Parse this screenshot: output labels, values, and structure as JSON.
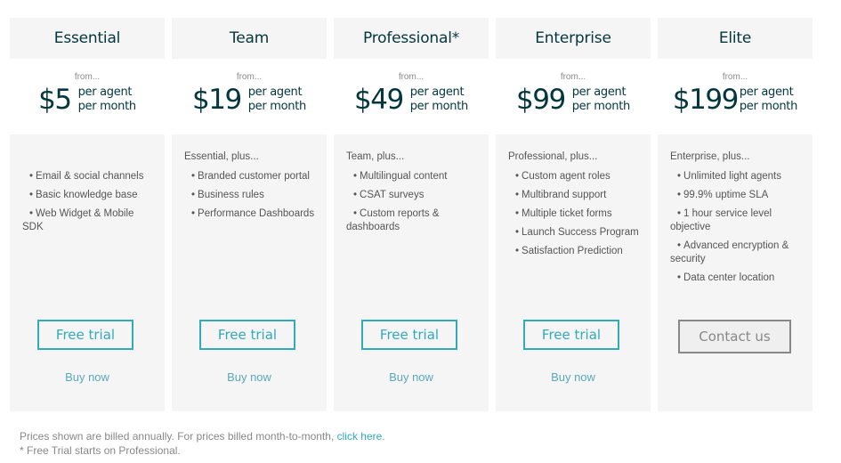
{
  "colors": {
    "accent": "#30aabc",
    "heading": "#03363d",
    "panel_bg": "#f5f5f5",
    "muted": "#888888"
  },
  "plans": [
    {
      "name": "Essential",
      "from": "from...",
      "price": "$5",
      "per_line1": "per agent",
      "per_line2": "per month",
      "intro": "",
      "features": [
        "Email & social channels",
        "Basic knowledge base",
        "Web Widget & Mobile SDK"
      ],
      "cta": "Free trial",
      "buy": "Buy now"
    },
    {
      "name": "Team",
      "from": "from...",
      "price": "$19",
      "per_line1": "per agent",
      "per_line2": "per month",
      "intro": "Essential, plus...",
      "features": [
        "Branded customer portal",
        "Business rules",
        "Performance Dashboards"
      ],
      "cta": "Free trial",
      "buy": "Buy now"
    },
    {
      "name": "Professional*",
      "from": "from...",
      "price": "$49",
      "per_line1": "per agent",
      "per_line2": "per month",
      "intro": "Team, plus...",
      "features": [
        "Multilingual content",
        "CSAT surveys",
        "Custom reports & dashboards"
      ],
      "cta": "Free trial",
      "buy": "Buy now"
    },
    {
      "name": "Enterprise",
      "from": "from...",
      "price": "$99",
      "per_line1": "per agent",
      "per_line2": "per month",
      "intro": "Professional, plus...",
      "features": [
        "Custom agent roles",
        "Multibrand support",
        "Multiple ticket forms",
        "Launch Success Program",
        "Satisfaction Prediction"
      ],
      "cta": "Free trial",
      "buy": "Buy now"
    },
    {
      "name": "Elite",
      "from": "from...",
      "price": "$199",
      "per_line1": "per agent",
      "per_line2": "per month",
      "intro": "Enterprise, plus...",
      "features": [
        "Unlimited light agents",
        "99.9% uptime SLA",
        "1 hour service level objective",
        "Advanced encryption & security",
        "Data center location"
      ],
      "cta": "Contact us",
      "buy": ""
    }
  ],
  "footer": {
    "billing_note": "Prices shown are billed annually. For prices billed month-to-month, ",
    "billing_link": "click here",
    "billing_end": ".",
    "trial_note": "* Free Trial starts on Professional."
  }
}
